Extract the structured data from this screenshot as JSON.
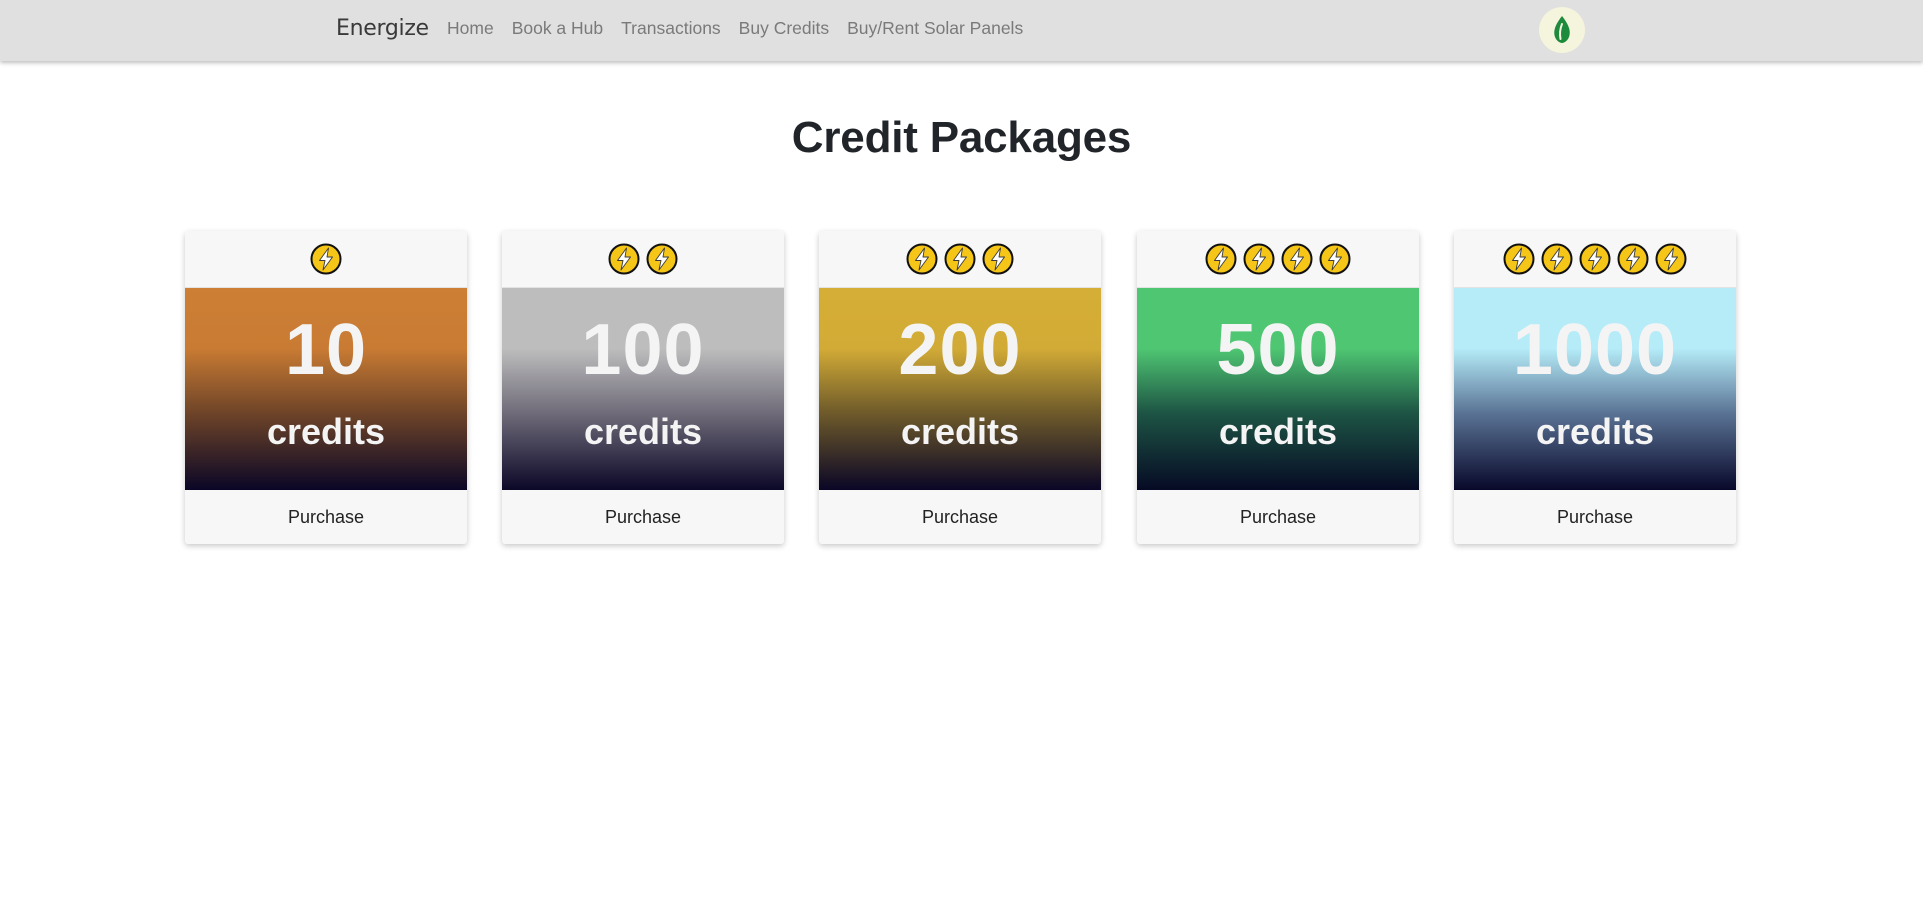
{
  "nav": {
    "brand": "Energize",
    "links": [
      "Home",
      "Book a Hub",
      "Transactions",
      "Buy Credits",
      "Buy/Rent Solar Panels"
    ],
    "avatar_icon": "leaf-icon"
  },
  "page": {
    "title": "Credit Packages"
  },
  "packages": [
    {
      "bolts": 1,
      "amount": "10",
      "unit": "credits",
      "action": "Purchase",
      "color": "#cc7f35"
    },
    {
      "bolts": 2,
      "amount": "100",
      "unit": "credits",
      "action": "Purchase",
      "color": "#bdbdbd"
    },
    {
      "bolts": 3,
      "amount": "200",
      "unit": "credits",
      "action": "Purchase",
      "color": "#d5ae37"
    },
    {
      "bolts": 4,
      "amount": "500",
      "unit": "credits",
      "action": "Purchase",
      "color": "#4fc672"
    },
    {
      "bolts": 5,
      "amount": "1000",
      "unit": "credits",
      "action": "Purchase",
      "color": "#b5ecf8"
    }
  ],
  "icons": {
    "bolt": "lightning-bolt-icon"
  },
  "colors": {
    "navbar": "#e0e0e0",
    "bolt_fill": "#f5c518",
    "leaf": "#1e8a3c"
  }
}
